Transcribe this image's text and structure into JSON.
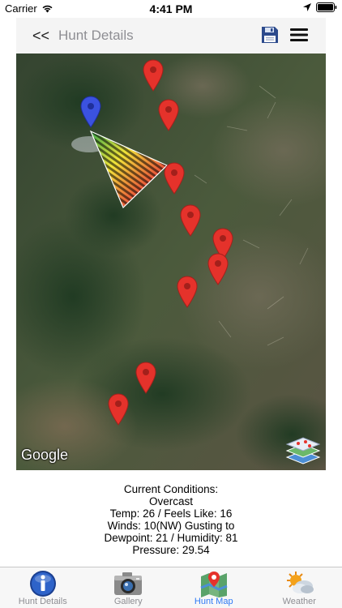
{
  "status_bar": {
    "carrier": "Carrier",
    "time": "4:41 PM"
  },
  "nav": {
    "back_label": "<<",
    "title": "Hunt Details",
    "save_icon": "floppy-disk-icon",
    "menu_icon": "hamburger-menu-icon"
  },
  "map": {
    "attribution": "Google",
    "layers_icon": "map-layers-icon",
    "colors": {
      "red_pin": "#e5322b",
      "blue_pin": "#3b52e0"
    }
  },
  "conditions": {
    "heading": "Current Conditions:",
    "sky": "Overcast",
    "temp": "Temp: 26 / Feels Like: 16",
    "winds": "Winds: 10(NW) Gusting to",
    "dewpoint": "Dewpoint: 21 / Humidity: 81",
    "pressure": "Pressure: 29.54"
  },
  "tabs": [
    {
      "label": "Hunt Details",
      "icon": "info-icon",
      "active": false
    },
    {
      "label": "Gallery",
      "icon": "camera-icon",
      "active": false
    },
    {
      "label": "Hunt Map",
      "icon": "map-icon",
      "active": true
    },
    {
      "label": "Weather",
      "icon": "weather-icon",
      "active": false
    }
  ],
  "colors": {
    "accent": "#2f7bf6",
    "inactive_tab": "#8e8e93"
  }
}
